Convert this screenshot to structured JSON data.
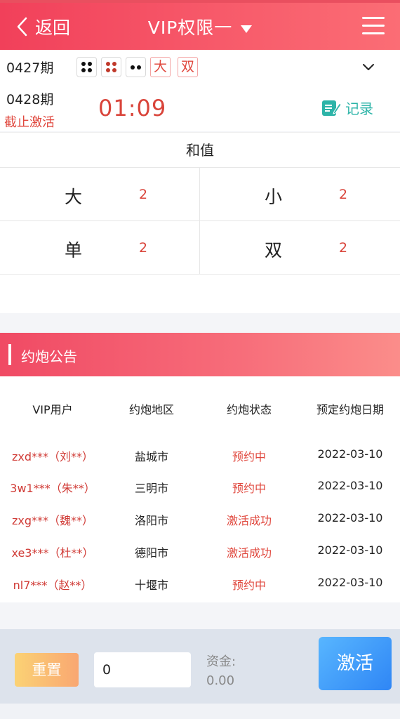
{
  "header": {
    "back_label": "返回",
    "title": "VIP权限一"
  },
  "period": {
    "previous_label": "0427期",
    "dice": [
      4,
      4,
      2
    ],
    "result_tags": [
      "大",
      "双"
    ],
    "current_label": "0428期",
    "status_text": "截止激活",
    "countdown": "01:09",
    "record_label": "记录"
  },
  "sum": {
    "heading": "和值",
    "cells": [
      {
        "label": "大",
        "value": "2"
      },
      {
        "label": "小",
        "value": "2"
      },
      {
        "label": "单",
        "value": "2"
      },
      {
        "label": "双",
        "value": "2"
      }
    ]
  },
  "notice": {
    "title": "约炮公告",
    "columns": [
      "VIP用户",
      "约炮地区",
      "约炮状态",
      "预定约炮日期"
    ],
    "rows": [
      {
        "user": "zxd***（刘**）",
        "region": "盐城市",
        "status": "预约中",
        "date": "2022-03-10"
      },
      {
        "user": "3w1***（朱**）",
        "region": "三明市",
        "status": "预约中",
        "date": "2022-03-10"
      },
      {
        "user": "zxg***（魏**）",
        "region": "洛阳市",
        "status": "激活成功",
        "date": "2022-03-10"
      },
      {
        "user": "xe3***（杜**）",
        "region": "德阳市",
        "status": "激活成功",
        "date": "2022-03-10"
      },
      {
        "user": "nl7***（赵**）",
        "region": "十堰市",
        "status": "预约中",
        "date": "2022-03-10"
      }
    ]
  },
  "footer": {
    "reset_label": "重置",
    "amount_value": "0",
    "fund_label": "资金:",
    "fund_value": "0.00",
    "activate_label": "激活"
  },
  "colors": {
    "header": "#f1405a",
    "accent_red": "#d9443a",
    "record_teal": "#2db4a8",
    "activate_blue": "#2f86f5"
  }
}
